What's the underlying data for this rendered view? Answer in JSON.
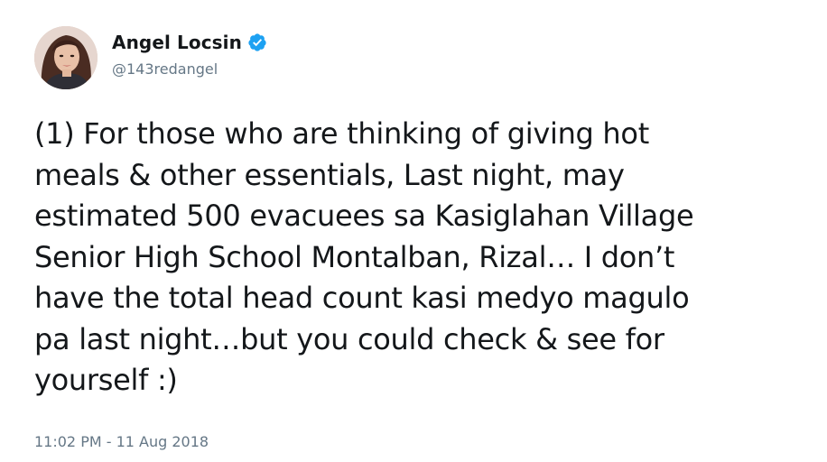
{
  "tweet": {
    "author": {
      "display_name": "Angel Locsin",
      "handle": "@143redangel",
      "verified": true
    },
    "text": "(1) For those who are thinking of giving hot\nmeals & other essentials, Last night, may\nestimated 500 evacuees sa Kasiglahan Village\nSenior High School Montalban, Rizal… I don’t\nhave the total head count kasi medyo magulo\npa last night…but you could check & see for\nyourself :)",
    "timestamp": "11:02 PM - 11 Aug 2018"
  },
  "colors": {
    "text_primary": "#14171a",
    "text_secondary": "#657786",
    "verified_blue": "#1da1f2",
    "background": "#ffffff"
  },
  "icons": {
    "verified": "verified-badge-icon",
    "avatar": "profile-avatar"
  }
}
